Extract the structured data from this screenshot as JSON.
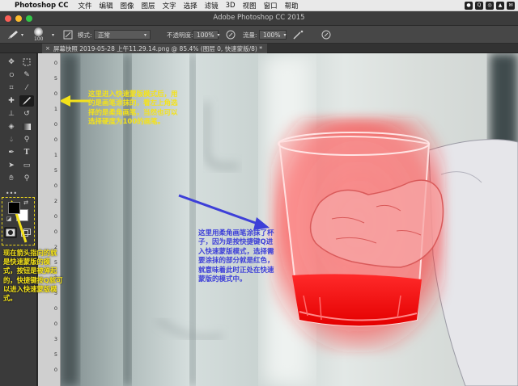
{
  "menubar": {
    "app_name": "Photoshop CC",
    "items": [
      "文件",
      "编辑",
      "图像",
      "图层",
      "文字",
      "选择",
      "滤镜",
      "3D",
      "视图",
      "窗口",
      "帮助"
    ]
  },
  "window": {
    "title": "Adobe Photoshop CC 2015"
  },
  "options": {
    "brush_size": "100",
    "mode_label": "模式:",
    "mode_value": "正常",
    "opacity_label": "不透明度:",
    "opacity_value": "100%",
    "flow_label": "流量:",
    "flow_value": "100%"
  },
  "tab": {
    "title": "屏幕快照 2019-05-28 上午11.29.14.png @ 85.4% (图层 0, 快速蒙版/8) *",
    "close": "×"
  },
  "ruler": {
    "marks": [
      "0",
      "5",
      "0",
      "1",
      "0",
      "0",
      "1",
      "5",
      "0",
      "2",
      "0",
      "0",
      "2",
      "5",
      "0",
      "3",
      "0",
      "0",
      "3",
      "5",
      "0"
    ]
  },
  "annotations": {
    "top": "这里进入快速蒙版模式后，用的是画笔涂抹的，看左上角选择的是柔角画笔，当然也可以选择硬度为100的画笔。",
    "left": "现在箭头指向的就是快速蒙版的模式，按钮是被弹起的，快捷键按Q就可以进入快速蒙版模式。",
    "middle": "这里用柔角画笔涂抹了杯子，因为是按快捷键Q进入快速蒙版模式，选择需要涂抹的部分就是红色，就意味着此时正处在快速蒙版的模式中。"
  },
  "colors": {
    "annotation_yellow": "#f4e21a",
    "annotation_blue": "#3d3fd8",
    "mask_red": "#ff2020",
    "highlight_box": "#e6d21e"
  },
  "icons": {
    "move": "move-icon",
    "marquee": "marquee-icon",
    "lasso": "lasso-icon",
    "crop": "crop-icon",
    "brush": "brush-icon",
    "eraser": "eraser-icon",
    "pen": "pen-icon",
    "text": "text-icon",
    "hand": "hand-icon",
    "zoom": "zoom-icon",
    "quick_mask": "quick-mask-icon",
    "screen_mode": "screen-mode-icon"
  }
}
